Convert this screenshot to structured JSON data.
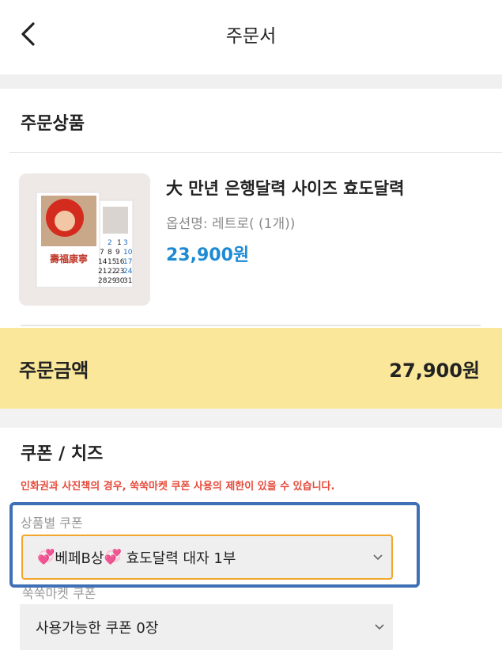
{
  "header": {
    "title": "주문서"
  },
  "order_items": {
    "section_title": "주문상품",
    "product": {
      "name": "大 만년 은행달력 사이즈 효도달력",
      "option": "옵션명: 레트로( (1개))",
      "price": "23,900원",
      "thumbnail": {
        "calendar_title": "壽福康寧",
        "calendar_numbers": [
          "1",
          "2",
          "3",
          "7",
          "8",
          "9",
          "10",
          "14",
          "15",
          "16",
          "17",
          "21",
          "22",
          "23",
          "24",
          "28",
          "29",
          "30",
          "31"
        ]
      }
    }
  },
  "total": {
    "label": "주문금액",
    "value": "27,900원"
  },
  "coupon": {
    "section_title": "쿠폰 / 치즈",
    "notice": "인화권과 사진책의 경우, 쑥쑥마켓 쿠폰 사용의 제한이 있을 수 있습니다.",
    "product_coupon": {
      "label": "상품별 쿠폰",
      "selected_prefix": "💞",
      "selected_mid1": "베페B상",
      "selected_mid2": "💞",
      "selected_rest": " 효도달력 대자 1부"
    },
    "market_coupon": {
      "label": "쑥쑥마켓 쿠폰",
      "selected": "사용가능한 쿠폰 0장"
    }
  },
  "colors": {
    "accent_price": "#1f8ad4",
    "total_bar": "#fae79a",
    "notice": "#e64a3a",
    "select_focus_border": "#f3a62a",
    "highlight_border": "#3f6fb5"
  }
}
